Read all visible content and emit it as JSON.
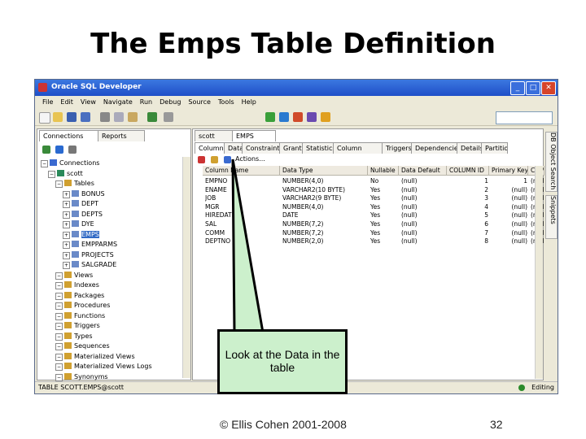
{
  "slide": {
    "title": "The Emps Table Definition",
    "callout": "Look at the Data in the table",
    "copyright": "© Ellis Cohen 2001-2008",
    "page_number": "32"
  },
  "window": {
    "title": "Oracle SQL Developer",
    "menu": [
      "File",
      "Edit",
      "View",
      "Navigate",
      "Run",
      "Debug",
      "Source",
      "Tools",
      "Help"
    ]
  },
  "left_panel": {
    "tabs": [
      "Connections",
      "Reports"
    ],
    "tree": [
      {
        "label": "Connections",
        "indent": 0
      },
      {
        "label": "scott",
        "indent": 1
      },
      {
        "label": "Tables",
        "indent": 2
      },
      {
        "label": "BONUS",
        "indent": 3
      },
      {
        "label": "DEPT",
        "indent": 3
      },
      {
        "label": "DEPTS",
        "indent": 3
      },
      {
        "label": "DYE",
        "indent": 3
      },
      {
        "label": "EMPS",
        "indent": 3,
        "selected": true
      },
      {
        "label": "EMPPARMS",
        "indent": 3
      },
      {
        "label": "PROJECTS",
        "indent": 3
      },
      {
        "label": "SALGRADE",
        "indent": 3
      },
      {
        "label": "Views",
        "indent": 2
      },
      {
        "label": "Indexes",
        "indent": 2
      },
      {
        "label": "Packages",
        "indent": 2
      },
      {
        "label": "Procedures",
        "indent": 2
      },
      {
        "label": "Functions",
        "indent": 2
      },
      {
        "label": "Triggers",
        "indent": 2
      },
      {
        "label": "Types",
        "indent": 2
      },
      {
        "label": "Sequences",
        "indent": 2
      },
      {
        "label": "Materialized Views",
        "indent": 2
      },
      {
        "label": "Materialized Views Logs",
        "indent": 2
      },
      {
        "label": "Synonyms",
        "indent": 2
      }
    ]
  },
  "editor": {
    "doc_tabs": [
      "scott",
      "EMPS"
    ],
    "sub_tabs": [
      "Columns",
      "Data",
      "Constraints",
      "Grants",
      "Statistics",
      "Column Statistics",
      "Triggers",
      "Dependencies",
      "Details",
      "Partitions"
    ],
    "actions_label": "Actions...",
    "columns": [
      "Column Name",
      "Data Type",
      "Nullable",
      "Data Default",
      "COLUMN ID",
      "Primary Key",
      "COMMENTS"
    ],
    "rows": [
      [
        "EMPNO",
        "NUMBER(4,0)",
        "No",
        "(null)",
        "1",
        "1",
        "(null)"
      ],
      [
        "ENAME",
        "VARCHAR2(10 BYTE)",
        "Yes",
        "(null)",
        "2",
        "(null)",
        "(null)"
      ],
      [
        "JOB",
        "VARCHAR2(9 BYTE)",
        "Yes",
        "(null)",
        "3",
        "(null)",
        "(null)"
      ],
      [
        "MGR",
        "NUMBER(4,0)",
        "Yes",
        "(null)",
        "4",
        "(null)",
        "(null)"
      ],
      [
        "HIREDATE",
        "DATE",
        "Yes",
        "(null)",
        "5",
        "(null)",
        "(null)"
      ],
      [
        "SAL",
        "NUMBER(7,2)",
        "Yes",
        "(null)",
        "6",
        "(null)",
        "(null)"
      ],
      [
        "COMM",
        "NUMBER(7,2)",
        "Yes",
        "(null)",
        "7",
        "(null)",
        "(null)"
      ],
      [
        "DEPTNO",
        "NUMBER(2,0)",
        "Yes",
        "(null)",
        "8",
        "(null)",
        "(null)"
      ]
    ]
  },
  "side_tabs": [
    "DB Object Search",
    "Snippets"
  ],
  "status": {
    "left": "TABLE SCOTT.EMPS@scott",
    "right": "Editing"
  }
}
